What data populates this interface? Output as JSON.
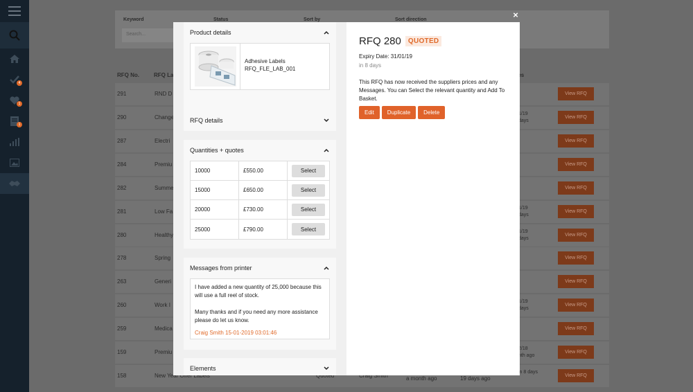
{
  "filters": {
    "keyword_label": "Keyword",
    "status_label": "Status",
    "sort_by_label": "Sort by",
    "sort_direction_label": "Sort direction",
    "search_placeholder": "Search..."
  },
  "table": {
    "col_rfq_no": "RFQ No.",
    "col_rfq_name": "RFQ La",
    "col_expires": "ires",
    "view_label": "View RFQ",
    "rows": [
      {
        "no": "291",
        "name": "RND D",
        "c1": "",
        "c2": ""
      },
      {
        "no": "290",
        "name": "Change",
        "c1": "1/19",
        "c2": "days"
      },
      {
        "no": "287",
        "name": "Electri",
        "c1": "",
        "c2": ""
      },
      {
        "no": "284",
        "name": "Premiu",
        "c1": "",
        "c2": ""
      },
      {
        "no": "282",
        "name": "Summe",
        "c1": "",
        "c2": ""
      },
      {
        "no": "281",
        "name": "Low Fa",
        "c1": "1/19",
        "c2": "days"
      },
      {
        "no": "280",
        "name": "Healthy",
        "c1": "1/19",
        "c2": "days"
      },
      {
        "no": "278",
        "name": "Spring",
        "c1": "",
        "c2": ""
      },
      {
        "no": "263",
        "name": "Generi",
        "c1": "",
        "c2": ""
      },
      {
        "no": "260",
        "name": "Work I",
        "c1": "1/19",
        "c2": "days"
      },
      {
        "no": "259",
        "name": "Medica",
        "c1": "",
        "c2": ""
      },
      {
        "no": "159",
        "name": "Premiu",
        "c1": "2/18",
        "c2": "nth ago"
      },
      {
        "no": "158",
        "name": "New Year Offer Labels",
        "c1": "in 8 days",
        "c2": ""
      }
    ],
    "row158_extra": {
      "status": "Quoted",
      "owner": "Craig Smith",
      "created": "a month ago",
      "updated": "19 days ago"
    }
  },
  "modal": {
    "product_details_title": "Product details",
    "product_name": "Adhesive Labels",
    "product_code": "RFQ_FLE_LAB_001",
    "rfq_details_title": "RFQ details",
    "quantities_title": "Quantities + quotes",
    "select_label": "Select",
    "quotes": [
      {
        "qty": "10000",
        "price": "£550.00"
      },
      {
        "qty": "15000",
        "price": "£650.00"
      },
      {
        "qty": "20000",
        "price": "£730.00"
      },
      {
        "qty": "25000",
        "price": "£790.00"
      }
    ],
    "messages_title": "Messages from printer",
    "message_p1": "I have added a new quantity of 25,000 because this will use a full reel of stock.",
    "message_p2": "Many thanks and if you need any more assistance please do let us know.",
    "message_author": "Craig Smith 15-01-2019 03:01:46",
    "elements_title": "Elements",
    "rfq_title": "RFQ 280",
    "status": "QUOTED",
    "expiry": "Expiry Date: 31/01/19",
    "in_days": "in 8 days",
    "description": "This RFQ has now received the suppliers prices and any Messages. You can Select the relevant quantity and Add To Basket.",
    "edit_label": "Edit",
    "duplicate_label": "Duplicate",
    "delete_label": "Delete",
    "close_symbol": "×"
  },
  "sidebar_badges": [
    "4",
    "1",
    "1"
  ],
  "colors": {
    "accent": "#e0622a",
    "sidebar": "#15212c",
    "quoted_bg": "#fbe9df"
  }
}
